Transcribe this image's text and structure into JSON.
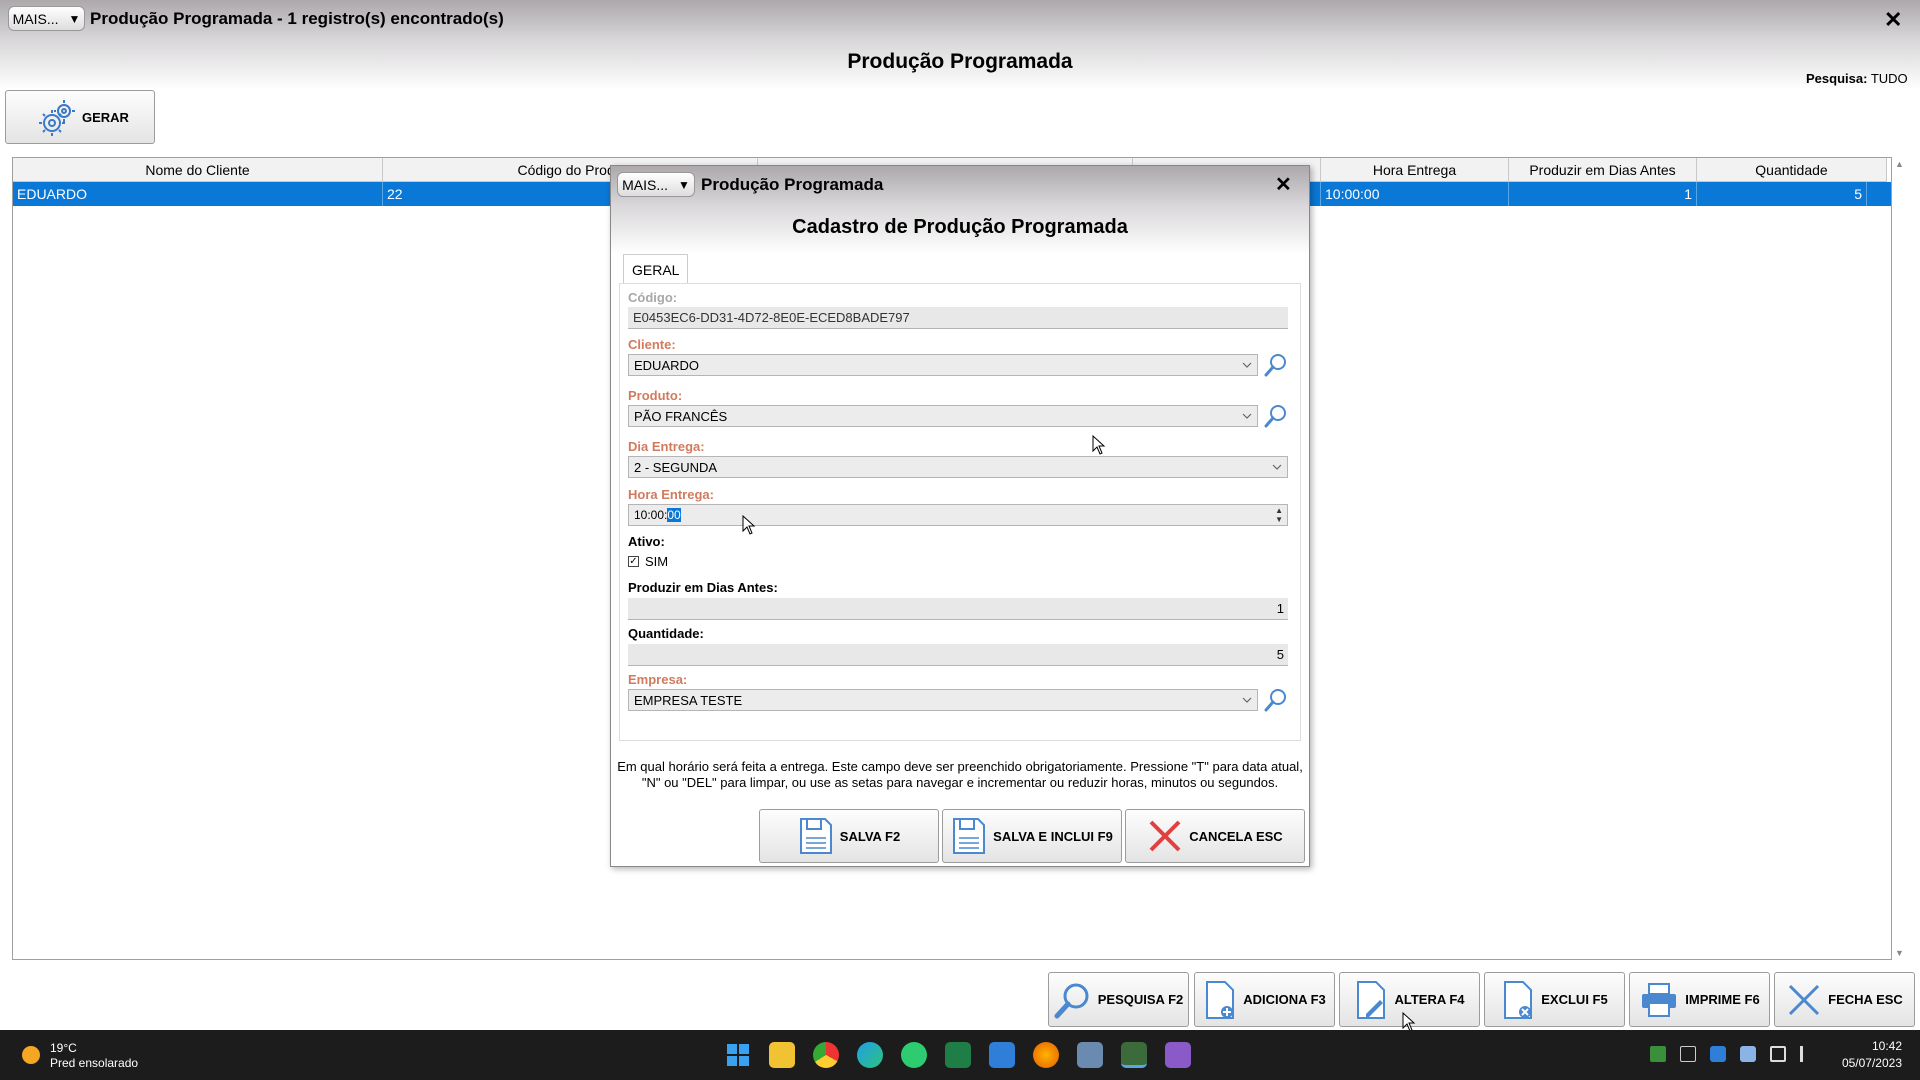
{
  "window": {
    "menu_label": "MAIS...",
    "title": "Produção Programada - 1 registro(s) encontrado(s)",
    "close": "✕",
    "heading": "Produção Programada",
    "search_label": "Pesquisa:",
    "search_value": "TUDO",
    "gerar_label": "GERAR"
  },
  "grid": {
    "columns": [
      "Nome do Cliente",
      "Código do Produ",
      "",
      "",
      "Hora Entrega",
      "Produzir em Dias Antes",
      "Quantidade"
    ],
    "row": [
      "EDUARDO",
      "22",
      "",
      "",
      "10:00:00",
      "1",
      "5"
    ]
  },
  "footer_buttons": {
    "pesquisa": "PESQUISA F2",
    "adiciona": "ADICIONA F3",
    "altera": "ALTERA F4",
    "exclui": "EXCLUI F5",
    "imprime": "IMPRIME F6",
    "fecha": "FECHA ESC"
  },
  "modal": {
    "menu_label": "MAIS...",
    "title": "Produção Programada",
    "close": "✕",
    "heading": "Cadastro de Produção Programada",
    "tab": "GERAL",
    "fields": {
      "codigo_label": "Código:",
      "codigo_value": "E0453EC6-DD31-4D72-8E0E-ECED8BADE797",
      "cliente_label": "Cliente:",
      "cliente_value": "EDUARDO",
      "produto_label": "Produto:",
      "produto_value": "PÃO FRANCÊS",
      "dia_label": "Dia Entrega:",
      "dia_value": "2 - SEGUNDA",
      "hora_label": "Hora Entrega:",
      "hora_value_prefix": "10:00:",
      "hora_value_selected": "00",
      "ativo_label": "Ativo:",
      "ativo_check": "SIM",
      "dias_label": "Produzir em Dias Antes:",
      "dias_value": "1",
      "qtd_label": "Quantidade:",
      "qtd_value": "5",
      "empresa_label": "Empresa:",
      "empresa_value": "EMPRESA TESTE"
    },
    "hint": "Em qual horário será feita a entrega. Este campo deve ser preenchido obrigatoriamente. Pressione \"T\" para data atual, \"N\" ou \"DEL\" para limpar, ou use as setas para navegar e incrementar ou reduzir horas, minutos ou segundos.",
    "buttons": {
      "salva": "SALVA F2",
      "salva_inclui": "SALVA E INCLUI F9",
      "cancela": "CANCELA ESC"
    }
  },
  "taskbar": {
    "weather_temp": "19°C",
    "weather_desc": "Pred ensolarado",
    "time": "10:42",
    "date": "05/07/2023"
  },
  "colors": {
    "selection": "#0a78d7",
    "required_label": "#d17b5e",
    "taskbar": "#1c1c1c"
  }
}
